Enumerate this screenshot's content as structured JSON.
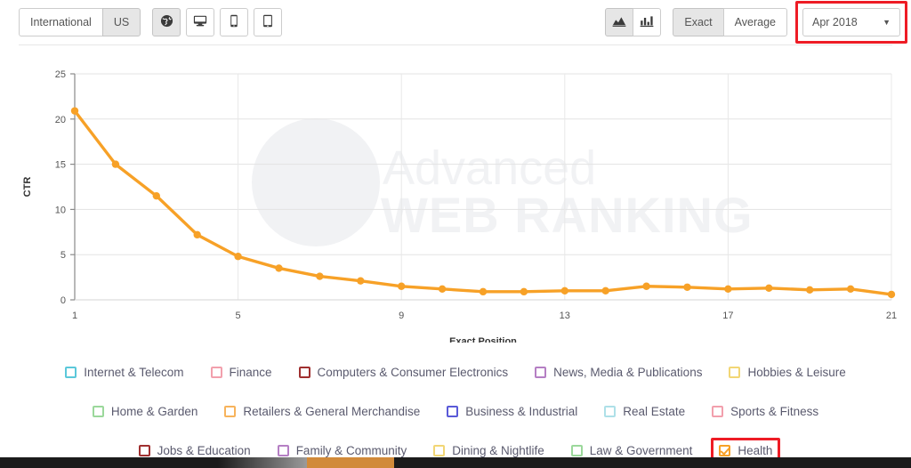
{
  "toolbar": {
    "region_buttons": [
      {
        "label": "International",
        "active": false,
        "name": "region-international-button"
      },
      {
        "label": "US",
        "active": true,
        "name": "region-us-button"
      }
    ],
    "device_buttons": [
      {
        "icon": "globe-icon",
        "active": true,
        "name": "device-all-button",
        "title": "All"
      },
      {
        "icon": "desktop-icon",
        "active": false,
        "name": "device-desktop-button",
        "title": "Desktop"
      },
      {
        "icon": "mobile-icon",
        "active": false,
        "name": "device-mobile-button",
        "title": "Mobile"
      },
      {
        "icon": "tablet-icon",
        "active": false,
        "name": "device-tablet-button",
        "title": "Tablet"
      }
    ],
    "view_buttons": [
      {
        "icon": "area-chart-icon",
        "active": true,
        "name": "view-area-chart-button"
      },
      {
        "icon": "bar-chart-icon",
        "active": false,
        "name": "view-bar-chart-button"
      }
    ],
    "mode_buttons": [
      {
        "label": "Exact",
        "active": true,
        "name": "mode-exact-button"
      },
      {
        "label": "Average",
        "active": false,
        "name": "mode-average-button"
      }
    ],
    "date_select": {
      "value": "Apr 2018",
      "caret": "▼",
      "highlighted": true,
      "highlight_color": "#ee1c25"
    }
  },
  "chart_data": {
    "type": "line",
    "title": "",
    "xlabel": "Exact Position",
    "ylabel": "CTR",
    "xlim": [
      1,
      21
    ],
    "ylim": [
      0,
      25
    ],
    "xticks": [
      1,
      5,
      9,
      13,
      17,
      21
    ],
    "yticks": [
      0,
      5,
      10,
      15,
      20,
      25
    ],
    "grid": true,
    "line_color": "#f7a127",
    "marker_color": "#f7a127",
    "legend_position": "bottom",
    "x": [
      1,
      2,
      3,
      4,
      5,
      6,
      7,
      8,
      9,
      10,
      11,
      12,
      13,
      14,
      15,
      16,
      17,
      18,
      19,
      20,
      21
    ],
    "series": [
      {
        "name": "Health",
        "color": "#f7a127",
        "values": [
          20.9,
          15.0,
          11.5,
          7.2,
          4.8,
          3.5,
          2.6,
          2.1,
          1.5,
          1.2,
          0.9,
          0.9,
          1.0,
          1.0,
          1.5,
          1.4,
          1.2,
          1.3,
          1.1,
          1.2,
          0.6
        ]
      }
    ],
    "watermark": {
      "line1": "Advanced",
      "line2": "WEB RANKING",
      "color": "#f1f2f4"
    }
  },
  "legend": {
    "rows": [
      [
        {
          "label": "Internet & Telecom",
          "color": "#5bc8da",
          "checked": false
        },
        {
          "label": "Finance",
          "color": "#f2a0ad",
          "checked": false
        },
        {
          "label": "Computers & Consumer Electronics",
          "color": "#a03030",
          "checked": false
        },
        {
          "label": "News, Media & Publications",
          "color": "#b57fc4",
          "checked": false
        },
        {
          "label": "Hobbies & Leisure",
          "color": "#f2d675",
          "checked": false
        }
      ],
      [
        {
          "label": "Home & Garden",
          "color": "#9bd89b",
          "checked": false
        },
        {
          "label": "Retailers & General Merchandise",
          "color": "#f7b35c",
          "checked": false
        },
        {
          "label": "Business & Industrial",
          "color": "#5a5ad8",
          "checked": false
        },
        {
          "label": "Real Estate",
          "color": "#aee0e8",
          "checked": false
        },
        {
          "label": "Sports & Fitness",
          "color": "#f2a0ad",
          "checked": false
        }
      ],
      [
        {
          "label": "Jobs & Education",
          "color": "#a03030",
          "checked": false
        },
        {
          "label": "Family & Community",
          "color": "#b57fc4",
          "checked": false
        },
        {
          "label": "Dining & Nightlife",
          "color": "#f2d675",
          "checked": false
        },
        {
          "label": "Law & Government",
          "color": "#9bd89b",
          "checked": false
        },
        {
          "label": "Health",
          "color": "#f7a127",
          "checked": true,
          "highlighted": true
        }
      ]
    ]
  }
}
